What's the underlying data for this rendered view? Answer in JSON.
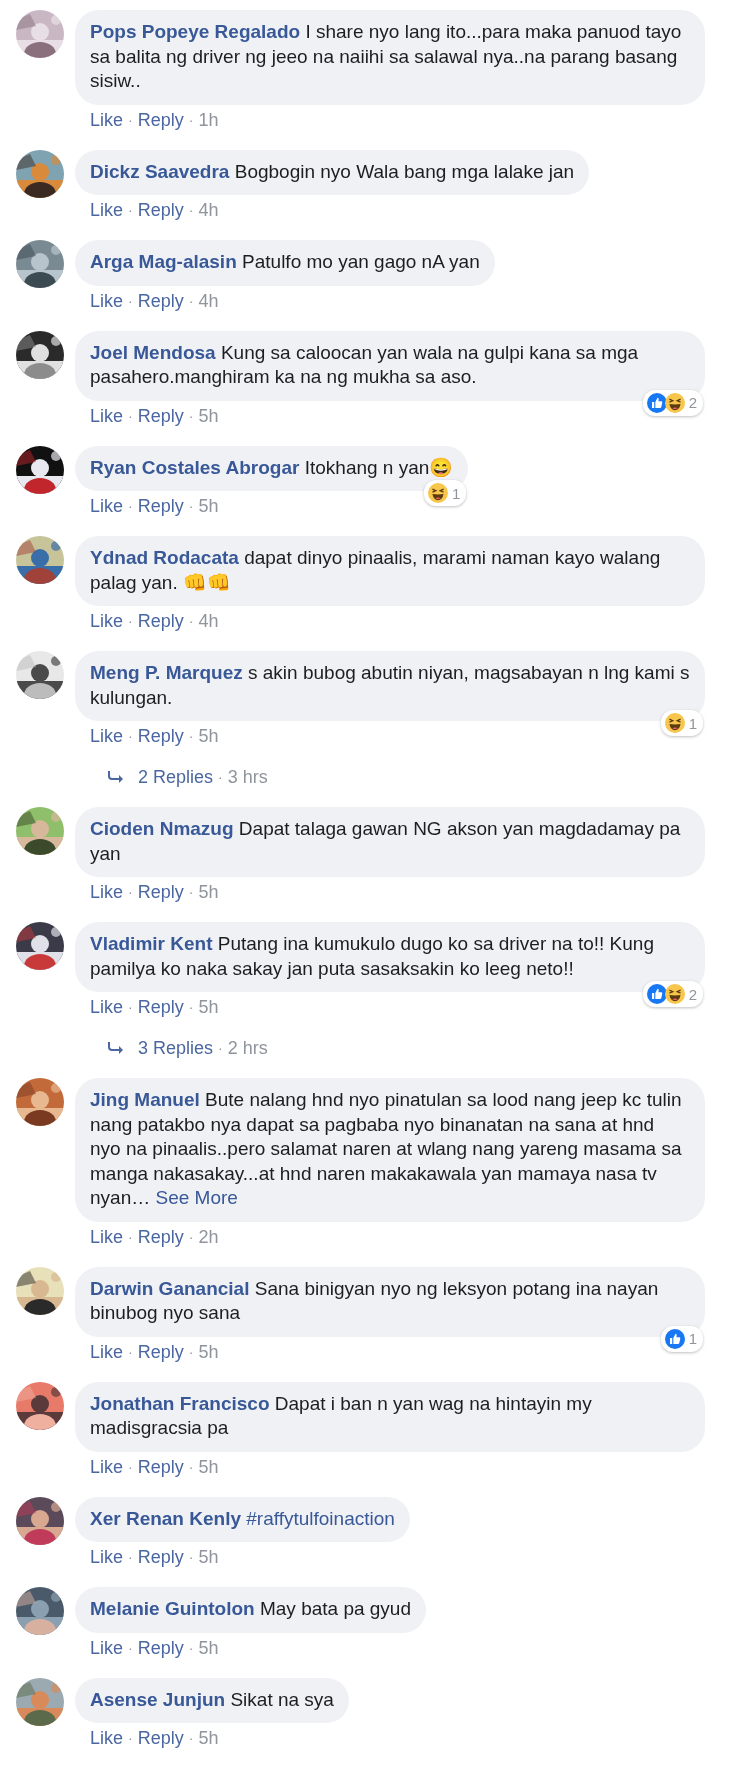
{
  "comments": [
    {
      "author": "Pops Popeye Regalado",
      "text": "I share nyo lang ito...para maka panuod tayo sa balita ng driver ng jeeo na naiihi sa salawal nya..na parang basang sisiw..",
      "meta": [
        {
          "kind": "link",
          "text": "Like"
        },
        {
          "kind": "sep",
          "text": "·"
        },
        {
          "kind": "link",
          "text": "Reply"
        },
        {
          "kind": "sep",
          "text": "·"
        },
        {
          "kind": "time",
          "text": "1h"
        }
      ]
    },
    {
      "author": "Dickz Saavedra",
      "text": "Bogbogin nyo Wala bang mga lalake jan",
      "meta": [
        {
          "kind": "link",
          "text": "Like"
        },
        {
          "kind": "sep",
          "text": "·"
        },
        {
          "kind": "link",
          "text": "Reply"
        },
        {
          "kind": "sep",
          "text": "·"
        },
        {
          "kind": "time",
          "text": "4h"
        }
      ]
    },
    {
      "author": "Arga Mag-alasin",
      "text": "Patulfo mo yan gago nA yan",
      "meta": [
        {
          "kind": "link",
          "text": "Like"
        },
        {
          "kind": "sep",
          "text": "·"
        },
        {
          "kind": "link",
          "text": "Reply"
        },
        {
          "kind": "sep",
          "text": "·"
        },
        {
          "kind": "time",
          "text": "4h"
        }
      ]
    },
    {
      "author": "Joel Mendosa",
      "text": "Kung sa caloocan yan wala na gulpi kana sa mga pasahero.manghiram ka na ng mukha sa aso.",
      "meta": [
        {
          "kind": "link",
          "text": "Like"
        },
        {
          "kind": "sep",
          "text": "·"
        },
        {
          "kind": "link",
          "text": "Reply"
        },
        {
          "kind": "sep",
          "text": "·"
        },
        {
          "kind": "time",
          "text": "5h"
        }
      ],
      "reactions": {
        "items": [
          {
            "kind": "like"
          },
          {
            "kind": "haha"
          }
        ],
        "count": "2"
      }
    },
    {
      "author": "Ryan Costales Abrogar",
      "text": "Itokhang n yan😄",
      "meta": [
        {
          "kind": "link",
          "text": "Like"
        },
        {
          "kind": "sep",
          "text": "·"
        },
        {
          "kind": "link",
          "text": "Reply"
        },
        {
          "kind": "sep",
          "text": "·"
        },
        {
          "kind": "time",
          "text": "5h"
        }
      ],
      "reactions": {
        "items": [
          {
            "kind": "haha"
          }
        ],
        "count": "1"
      }
    },
    {
      "author": "Ydnad Rodacata",
      "text": "dapat dinyo pinaalis, marami naman kayo walang palag yan. 👊👊",
      "meta": [
        {
          "kind": "link",
          "text": "Like"
        },
        {
          "kind": "sep",
          "text": "·"
        },
        {
          "kind": "link",
          "text": "Reply"
        },
        {
          "kind": "sep",
          "text": "·"
        },
        {
          "kind": "time",
          "text": "4h"
        }
      ]
    },
    {
      "author": "Meng P. Marquez",
      "text": "s akin bubog abutin niyan, magsabayan n lng kami s kulungan.",
      "meta": [
        {
          "kind": "link",
          "text": "Like"
        },
        {
          "kind": "sep",
          "text": "·"
        },
        {
          "kind": "link",
          "text": "Reply"
        },
        {
          "kind": "sep",
          "text": "·"
        },
        {
          "kind": "time",
          "text": "5h"
        }
      ],
      "reactions": {
        "items": [
          {
            "kind": "haha"
          }
        ],
        "count": "1"
      },
      "replies": {
        "label": "2 Replies",
        "separator": "·",
        "time": "3 hrs"
      }
    },
    {
      "author": "Cioden Nmazug",
      "text": "Dapat talaga gawan NG akson yan magdadamay pa yan",
      "meta": [
        {
          "kind": "link",
          "text": "Like"
        },
        {
          "kind": "sep",
          "text": "·"
        },
        {
          "kind": "link",
          "text": "Reply"
        },
        {
          "kind": "sep",
          "text": "·"
        },
        {
          "kind": "time",
          "text": "5h"
        }
      ]
    },
    {
      "author": "Vladimir Kent",
      "text": "Putang ina kumukulo dugo ko sa driver na to!! Kung pamilya ko naka sakay jan puta sasaksakin ko leeg neto!!",
      "meta": [
        {
          "kind": "link",
          "text": "Like"
        },
        {
          "kind": "sep",
          "text": "·"
        },
        {
          "kind": "link",
          "text": "Reply"
        },
        {
          "kind": "sep",
          "text": "·"
        },
        {
          "kind": "time",
          "text": "5h"
        }
      ],
      "reactions": {
        "items": [
          {
            "kind": "like"
          },
          {
            "kind": "haha"
          }
        ],
        "count": "2"
      },
      "replies": {
        "label": "3 Replies",
        "separator": "·",
        "time": "2 hrs"
      }
    },
    {
      "author": "Jing Manuel",
      "text": "Bute nalang hnd nyo pinatulan sa lood nang jeep kc tulin nang patakbo nya dapat sa pagbaba nyo binanatan na sana at hnd nyo na pinaalis..pero salamat naren at wlang nang yareng masama sa manga nakasakay...at hnd naren makakawala yan mamaya nasa tv nyan…",
      "see_more": "See More",
      "meta": [
        {
          "kind": "link",
          "text": "Like"
        },
        {
          "kind": "sep",
          "text": "·"
        },
        {
          "kind": "link",
          "text": "Reply"
        },
        {
          "kind": "sep",
          "text": "·"
        },
        {
          "kind": "time",
          "text": "2h"
        }
      ]
    },
    {
      "author": "Darwin Ganancial",
      "text": "Sana binigyan nyo ng leksyon potang ina nayan binubog nyo sana",
      "meta": [
        {
          "kind": "link",
          "text": "Like"
        },
        {
          "kind": "sep",
          "text": "·"
        },
        {
          "kind": "link",
          "text": "Reply"
        },
        {
          "kind": "sep",
          "text": "·"
        },
        {
          "kind": "time",
          "text": "5h"
        }
      ],
      "reactions": {
        "items": [
          {
            "kind": "like"
          }
        ],
        "count": "1"
      }
    },
    {
      "author": "Jonathan Francisco",
      "text": "Dapat i ban n yan wag na hintayin my madisgracsia pa",
      "meta": [
        {
          "kind": "link",
          "text": "Like"
        },
        {
          "kind": "sep",
          "text": "·"
        },
        {
          "kind": "link",
          "text": "Reply"
        },
        {
          "kind": "sep",
          "text": "·"
        },
        {
          "kind": "time",
          "text": "5h"
        }
      ]
    },
    {
      "author": "Xer Renan Kenly",
      "hashtag": "#raffytulfoinaction",
      "meta": [
        {
          "kind": "link",
          "text": "Like"
        },
        {
          "kind": "sep",
          "text": "·"
        },
        {
          "kind": "link",
          "text": "Reply"
        },
        {
          "kind": "sep",
          "text": "·"
        },
        {
          "kind": "time",
          "text": "5h"
        }
      ]
    },
    {
      "author": "Melanie Guintolon",
      "text": "May bata pa gyud",
      "meta": [
        {
          "kind": "link",
          "text": "Like"
        },
        {
          "kind": "sep",
          "text": "·"
        },
        {
          "kind": "link",
          "text": "Reply"
        },
        {
          "kind": "sep",
          "text": "·"
        },
        {
          "kind": "time",
          "text": "5h"
        }
      ]
    },
    {
      "author": "Asense Junjun",
      "text": "Sikat na sya",
      "meta": [
        {
          "kind": "link",
          "text": "Like"
        },
        {
          "kind": "sep",
          "text": "·"
        },
        {
          "kind": "link",
          "text": "Reply"
        },
        {
          "kind": "sep",
          "text": "·"
        },
        {
          "kind": "time",
          "text": "5h"
        }
      ]
    }
  ]
}
